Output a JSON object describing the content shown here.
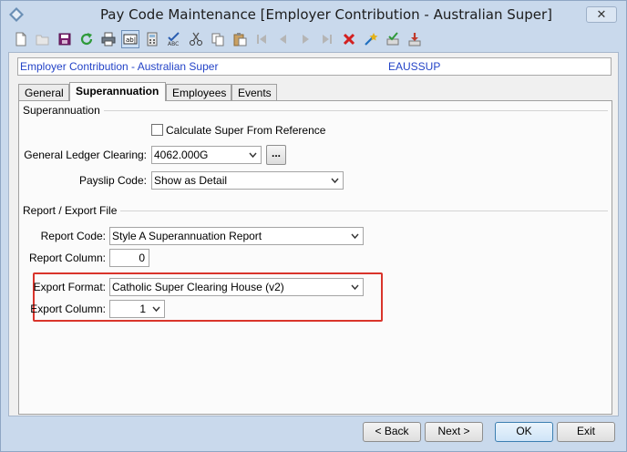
{
  "window": {
    "title": "Pay Code Maintenance  [Employer Contribution - Australian Super]",
    "close_glyph": "✕"
  },
  "toolbar": {
    "icons": [
      "new-icon",
      "open-icon",
      "save-icon",
      "refresh-icon",
      "print-icon",
      "text-field-icon",
      "calculator-icon",
      "spell-check-icon",
      "cut-icon",
      "copy-icon",
      "paste-icon",
      "first-record-icon",
      "previous-record-icon",
      "next-record-icon",
      "last-record-icon",
      "delete-icon",
      "wizard-icon",
      "approve-icon",
      "import-icon"
    ]
  },
  "header": {
    "name": "Employer Contribution - Australian Super",
    "code": "EAUSSUP"
  },
  "tabs": [
    {
      "label": "General"
    },
    {
      "label": "Superannuation"
    },
    {
      "label": "Employees"
    },
    {
      "label": "Events"
    }
  ],
  "superannuation": {
    "group_title": "Superannuation",
    "calc_from_reference_label": "Calculate Super From Reference",
    "calc_from_reference_checked": false,
    "gl_clearing_label": "General Ledger Clearing:",
    "gl_clearing_value": "4062.000G",
    "lookup_label": "...",
    "payslip_code_label": "Payslip Code:",
    "payslip_code_value": "Show as Detail"
  },
  "report_export": {
    "group_title": "Report / Export File",
    "report_code_label": "Report Code:",
    "report_code_value": "Style A Superannuation Report",
    "report_column_label": "Report Column:",
    "report_column_value": "0",
    "export_format_label": "Export Format:",
    "export_format_value": "Catholic Super Clearing House (v2)",
    "export_column_label": "Export Column:",
    "export_column_value": "1"
  },
  "buttons": {
    "back": "< Back",
    "next": "Next >",
    "ok": "OK",
    "exit": "Exit"
  },
  "colors": {
    "header_text": "#2343c7",
    "highlight": "#d9342b",
    "window_frame": "#c9d9ec"
  }
}
